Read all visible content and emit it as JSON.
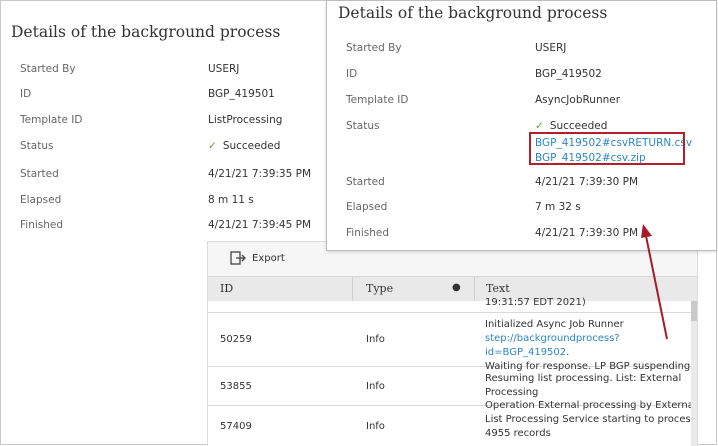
{
  "left_panel": {
    "title": "Details of the background process",
    "rows": [
      {
        "label": "Started By",
        "value": "USERJ"
      },
      {
        "label": "ID",
        "value": "BGP_419501"
      },
      {
        "label": "Template ID",
        "value": "ListProcessing"
      },
      {
        "label": "Status",
        "value": "Succeeded"
      },
      {
        "label": "Started",
        "value": "4/21/21 7:39:35 PM"
      },
      {
        "label": "Elapsed",
        "value": "8 m 11 s"
      },
      {
        "label": "Finished",
        "value": "4/21/21 7:39:45 PM"
      }
    ]
  },
  "log": {
    "export_label": "Export",
    "headers": {
      "id": "ID",
      "type": "Type",
      "text": "Text"
    },
    "partial_text": "19:31:57 EDT 2021)",
    "rows": [
      {
        "id": "50259",
        "type": "Info",
        "text_line1": "Initialized Async Job Runner",
        "text_link": "step://backgroundprocess?id=BGP_419502",
        "text_link_suffix": ".",
        "text_line3": "Waiting for response. LP BGP suspending."
      },
      {
        "id": "53855",
        "type": "Info",
        "text_line1": "Resuming list processing. List: External",
        "text_line2": "Processing"
      },
      {
        "id": "57409",
        "type": "Info",
        "text_line1": "Operation External processing by External",
        "text_line2": "List Processing Service starting to process",
        "text_line3": "4955 records"
      }
    ]
  },
  "right_panel": {
    "title": "Details of the background process",
    "rows": [
      {
        "label": "Started By",
        "value": "USERJ"
      },
      {
        "label": "ID",
        "value": "BGP_419502"
      },
      {
        "label": "Template ID",
        "value": "AsyncJobRunner"
      },
      {
        "label": "Status",
        "value": "Succeeded"
      },
      {
        "label": "Started",
        "value": "4/21/21 7:39:30 PM"
      },
      {
        "label": "Elapsed",
        "value": "7 m 32 s"
      },
      {
        "label": "Finished",
        "value": "4/21/21 7:39:30 PM"
      }
    ],
    "files": [
      "BGP_419502#csvRETURN.csv",
      "BGP_419502#csv.zip"
    ]
  },
  "colors": {
    "accent_red": "#b3202c",
    "link_blue": "#2b86c5",
    "success_green": "#5aa02c"
  },
  "icons": {
    "status": "check-icon",
    "export": "export-icon",
    "column_menu": "dot-icon"
  }
}
